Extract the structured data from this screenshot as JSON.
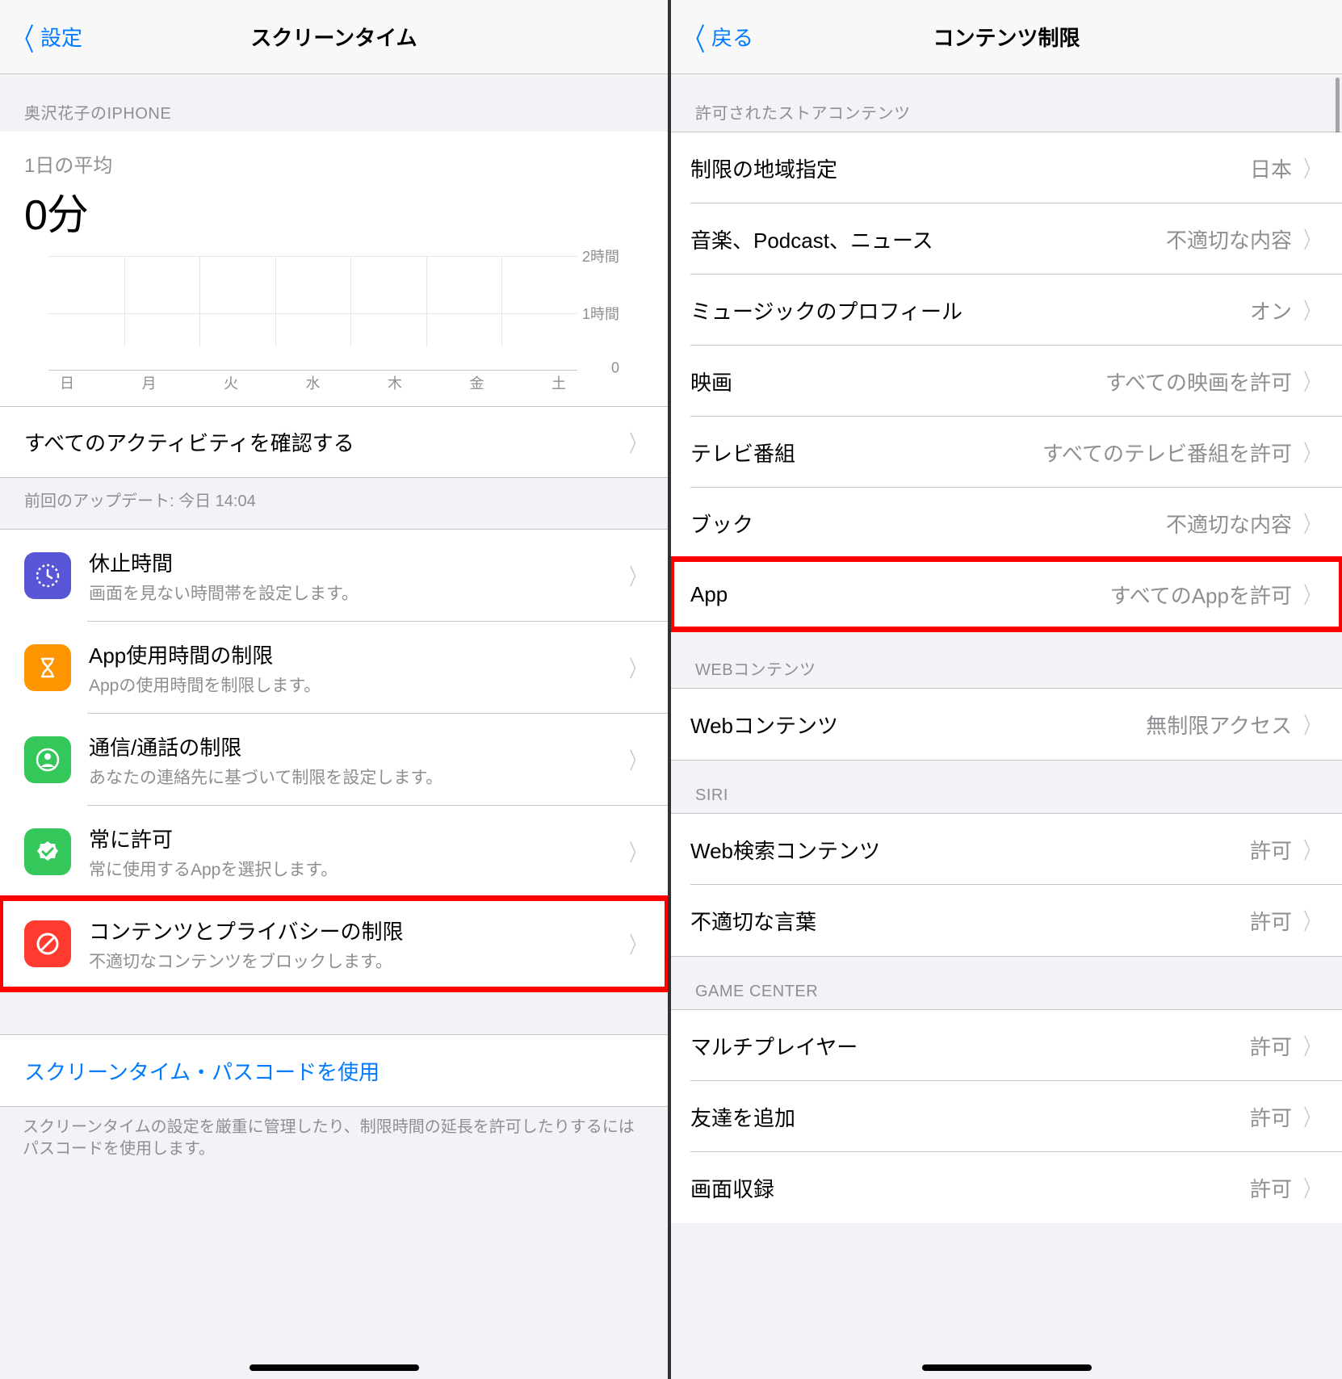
{
  "left": {
    "nav": {
      "back": "設定",
      "title": "スクリーンタイム"
    },
    "deviceHeader": "奥沢花子のIPHONE",
    "avgLabel": "1日の平均",
    "avgValue": "0分",
    "chart": {
      "yLabels": [
        "2時間",
        "1時間",
        "0"
      ],
      "days": [
        "日",
        "月",
        "火",
        "水",
        "木",
        "金",
        "土"
      ]
    },
    "activityRow": "すべてのアクティビティを確認する",
    "updateNote": "前回のアップデート: 今日 14:04",
    "items": [
      {
        "title": "休止時間",
        "sub": "画面を見ない時間帯を設定します。",
        "iconColor": "#5856d6",
        "iconName": "downtime-icon"
      },
      {
        "title": "App使用時間の制限",
        "sub": "Appの使用時間を制限します。",
        "iconColor": "#ff9500",
        "iconName": "hourglass-icon"
      },
      {
        "title": "通信/通話の制限",
        "sub": "あなたの連絡先に基づいて制限を設定します。",
        "iconColor": "#34c759",
        "iconName": "contact-icon"
      },
      {
        "title": "常に許可",
        "sub": "常に使用するAppを選択します。",
        "iconColor": "#34c759",
        "iconName": "check-icon"
      },
      {
        "title": "コンテンツとプライバシーの制限",
        "sub": "不適切なコンテンツをブロックします。",
        "iconColor": "#ff3b30",
        "iconName": "restrict-icon",
        "highlight": true
      }
    ],
    "passcodeLink": "スクリーンタイム・パスコードを使用",
    "passcodeNote": "スクリーンタイムの設定を厳重に管理したり、制限時間の延長を許可したりするにはパスコードを使用します。"
  },
  "right": {
    "nav": {
      "back": "戻る",
      "title": "コンテンツ制限"
    },
    "sections": [
      {
        "header": "許可されたストアコンテンツ",
        "rows": [
          {
            "label": "制限の地域指定",
            "value": "日本"
          },
          {
            "label": "音楽、Podcast、ニュース",
            "value": "不適切な内容"
          },
          {
            "label": "ミュージックのプロフィール",
            "value": "オン"
          },
          {
            "label": "映画",
            "value": "すべての映画を許可"
          },
          {
            "label": "テレビ番組",
            "value": "すべてのテレビ番組を許可"
          },
          {
            "label": "ブック",
            "value": "不適切な内容"
          },
          {
            "label": "App",
            "value": "すべてのAppを許可",
            "highlight": true
          }
        ]
      },
      {
        "header": "WEBコンテンツ",
        "rows": [
          {
            "label": "Webコンテンツ",
            "value": "無制限アクセス"
          }
        ]
      },
      {
        "header": "SIRI",
        "rows": [
          {
            "label": "Web検索コンテンツ",
            "value": "許可"
          },
          {
            "label": "不適切な言葉",
            "value": "許可"
          }
        ]
      },
      {
        "header": "GAME CENTER",
        "rows": [
          {
            "label": "マルチプレイヤー",
            "value": "許可"
          },
          {
            "label": "友達を追加",
            "value": "許可"
          },
          {
            "label": "画面収録",
            "value": "許可"
          }
        ]
      }
    ]
  },
  "chart_data": {
    "type": "bar",
    "title": "1日の平均 0分",
    "categories": [
      "日",
      "月",
      "火",
      "水",
      "木",
      "金",
      "土"
    ],
    "values": [
      0,
      0,
      0,
      0,
      0,
      0,
      0
    ],
    "ylabel": "時間",
    "ylim": [
      0,
      2
    ],
    "yticks": [
      0,
      1,
      2
    ],
    "ytick_labels": [
      "0",
      "1時間",
      "2時間"
    ]
  }
}
